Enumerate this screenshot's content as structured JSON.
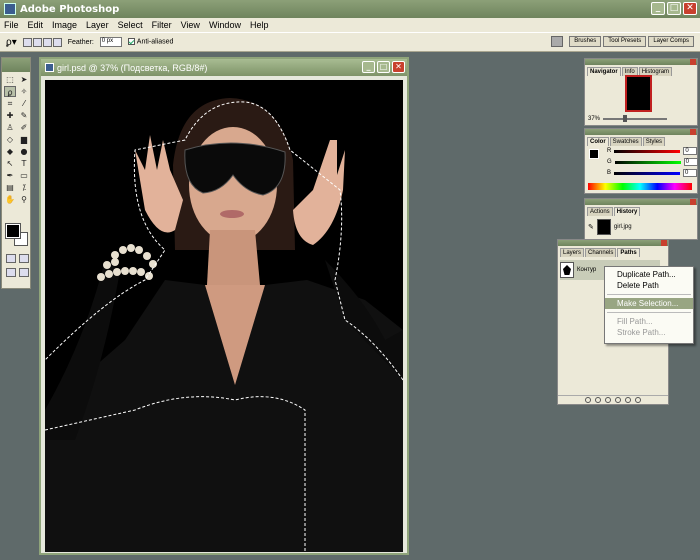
{
  "app": {
    "title": "Adobe Photoshop"
  },
  "menu": [
    "File",
    "Edit",
    "Image",
    "Layer",
    "Select",
    "Filter",
    "View",
    "Window",
    "Help"
  ],
  "options": {
    "feather_label": "Feather:",
    "feather_value": "0 px",
    "antialias_label": "Anti-aliased"
  },
  "well_tabs": [
    "Brushes",
    "Tool Presets",
    "Layer Comps"
  ],
  "document": {
    "title": "girl.psd @ 37% (Подсветка, RGB/8#)"
  },
  "navigator": {
    "tabs": [
      "Navigator",
      "Info",
      "Histogram"
    ],
    "zoom": "37%"
  },
  "color": {
    "tabs": [
      "Color",
      "Swatches",
      "Styles"
    ],
    "channels": [
      {
        "label": "R",
        "value": "0",
        "color": "#c02020"
      },
      {
        "label": "G",
        "value": "0",
        "color": "#20a040"
      },
      {
        "label": "B",
        "value": "0",
        "color": "#2040c0"
      }
    ]
  },
  "history": {
    "tabs": [
      "Actions",
      "History"
    ],
    "item": "girl.jpg"
  },
  "paths": {
    "tabs": [
      "Layers",
      "Channels",
      "Paths"
    ],
    "item": "Контур"
  },
  "context_menu": {
    "items": [
      "Duplicate Path...",
      "Delete Path"
    ],
    "make_selection": "Make Selection...",
    "disabled_items": [
      "Fill Path...",
      "Stroke Path..."
    ]
  }
}
